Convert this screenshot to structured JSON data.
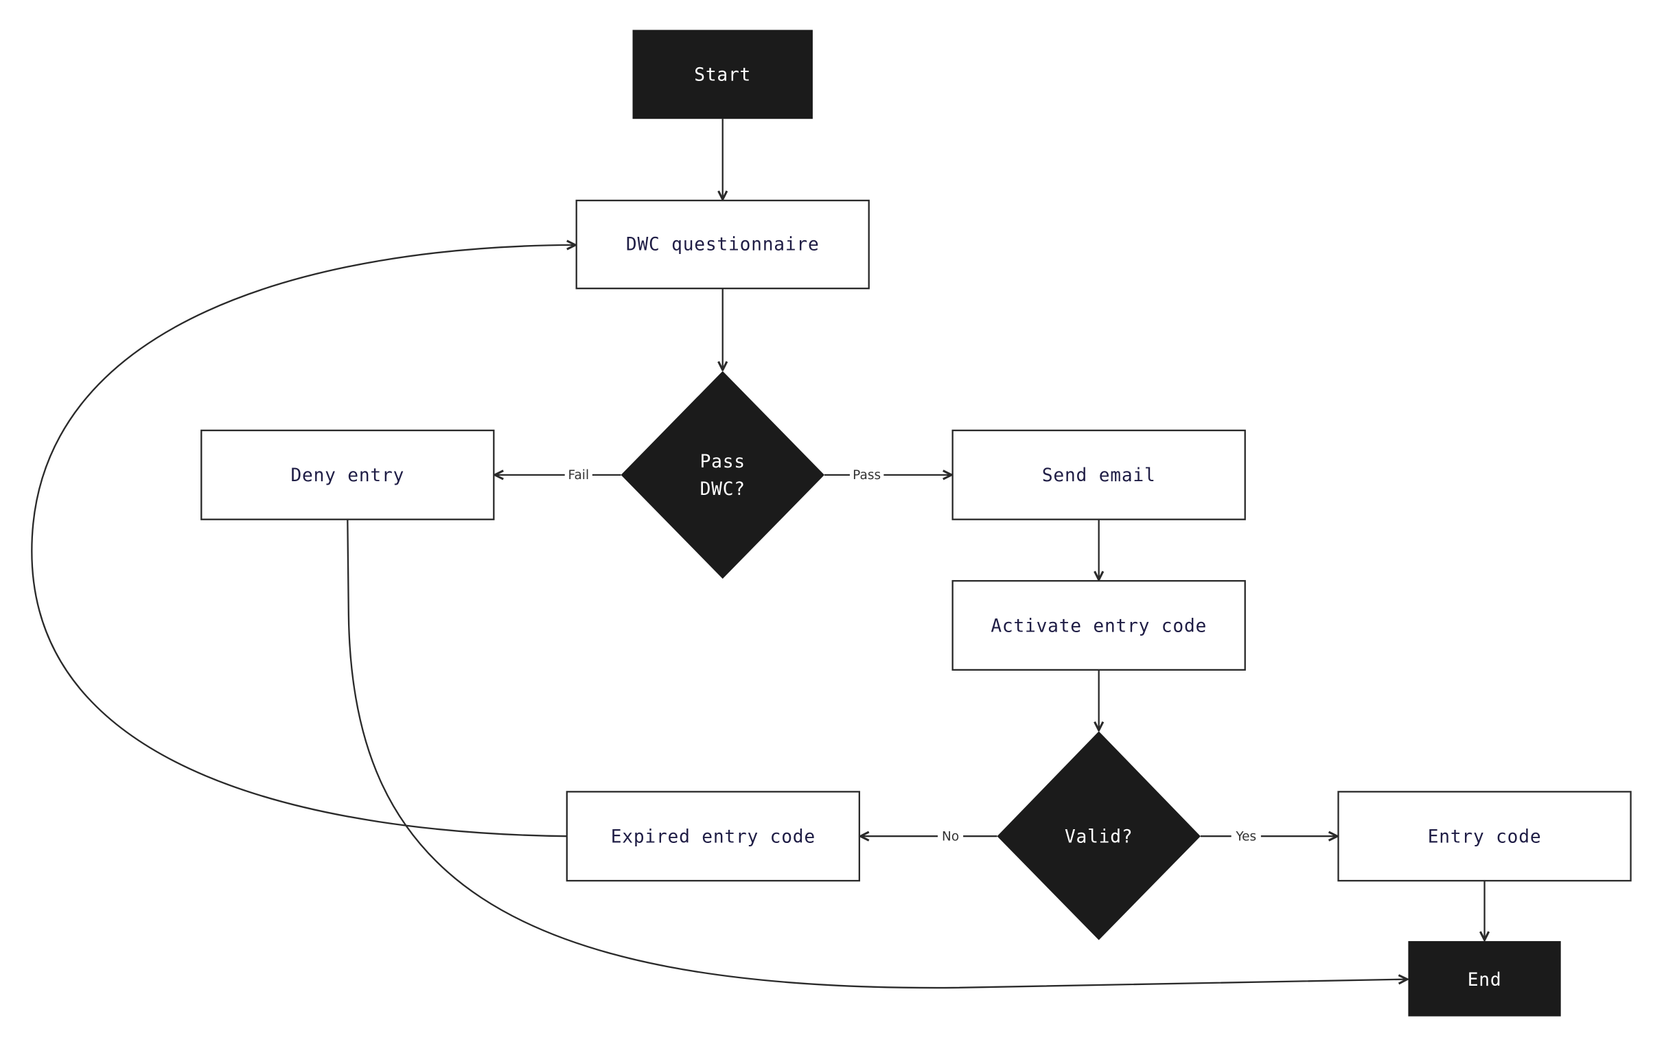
{
  "colors": {
    "dark_node": "#1b1b1b",
    "line": "#2a2a2a",
    "box_text": "#1f1d45",
    "dark_text": "#ffffff"
  },
  "nodes": {
    "start": "Start",
    "questionnaire": "DWC questionnaire",
    "pass_dwc_line1": "Pass",
    "pass_dwc_line2": "DWC?",
    "deny": "Deny entry",
    "send_email": "Send email",
    "activate": "Activate entry code",
    "valid": "Valid?",
    "expired": "Expired entry code",
    "entry_code": "Entry code",
    "end": "End"
  },
  "edges": {
    "fail": "Fail",
    "pass": "Pass",
    "no": "No",
    "yes": "Yes"
  }
}
